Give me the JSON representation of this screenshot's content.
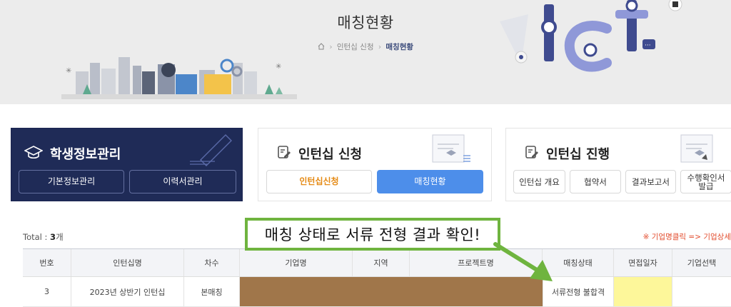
{
  "banner": {
    "title": "매칭현황",
    "breadcrumb": [
      "인턴십 신청",
      "매칭현황"
    ]
  },
  "student_card": {
    "title": "학생정보관리",
    "buttons": [
      "기본정보관리",
      "이력서관리"
    ]
  },
  "apply_card": {
    "title": "인턴십 신청",
    "buttons": [
      "인턴십신청",
      "매칭현황"
    ]
  },
  "progress_card": {
    "title": "인턴십 진행",
    "buttons": [
      "인턴십 개요",
      "협약서",
      "결과보고서"
    ],
    "last_button_line1": "수행확인서",
    "last_button_line2": "발급"
  },
  "list": {
    "total_prefix": "Total : ",
    "total_count": "3",
    "total_suffix": "개",
    "notice": "※ 기업명클릭 => 기업상세",
    "callout": "매칭 상태로 서류 전형 결과 확인!",
    "headers": [
      "번호",
      "인턴십명",
      "차수",
      "기업명",
      "지역",
      "프로젝트명",
      "매칭상태",
      "면접일자",
      "기업선택"
    ],
    "rows": [
      {
        "no": "3",
        "name": "2023년 상반기 인턴십",
        "round": "본매칭",
        "status": "서류전형 불합격"
      }
    ]
  },
  "colors": {
    "navy": "#1f2b57",
    "accent_blue": "#4d8eea",
    "accent_orange": "#e58a14",
    "callout_green": "#6fb43f",
    "redacted": "#a0764a",
    "highlight_yellow": "#fdf79a",
    "notice_red": "#e24b2c"
  }
}
